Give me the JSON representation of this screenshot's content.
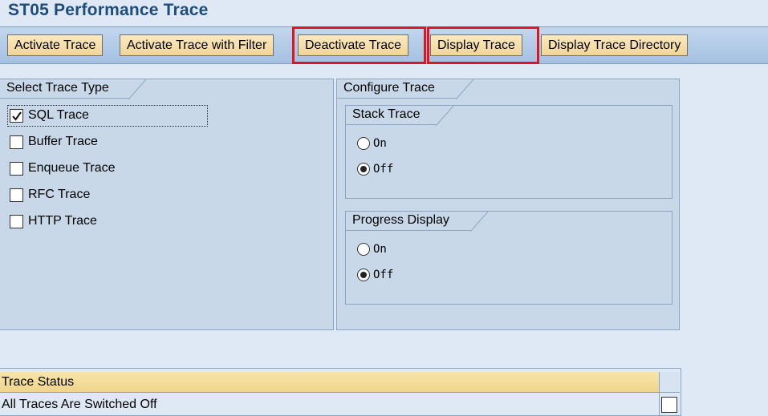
{
  "page": {
    "title": "ST05 Performance Trace"
  },
  "toolbar": {
    "activate_trace": "Activate Trace",
    "activate_trace_filter": "Activate Trace with Filter",
    "deactivate_trace": "Deactivate Trace",
    "display_trace": "Display Trace",
    "display_trace_directory": "Display Trace Directory"
  },
  "select_trace_type": {
    "title": "Select Trace Type",
    "items": [
      {
        "label": "SQL Trace",
        "checked": true
      },
      {
        "label": "Buffer Trace",
        "checked": false
      },
      {
        "label": "Enqueue Trace",
        "checked": false
      },
      {
        "label": "RFC Trace",
        "checked": false
      },
      {
        "label": "HTTP Trace",
        "checked": false
      }
    ]
  },
  "configure_trace": {
    "title": "Configure Trace",
    "stack_trace": {
      "title": "Stack Trace",
      "on_label": "On",
      "off_label": "Off",
      "selected": "Off"
    },
    "progress_display": {
      "title": "Progress Display",
      "on_label": "On",
      "off_label": "Off",
      "selected": "Off"
    }
  },
  "trace_status": {
    "header": "Trace Status",
    "value": "All Traces Are Switched Off"
  },
  "colors": {
    "title": "#1f4c7a",
    "button": "#f1d597",
    "highlight": "#e0161f",
    "panel": "#c8d8e8"
  }
}
